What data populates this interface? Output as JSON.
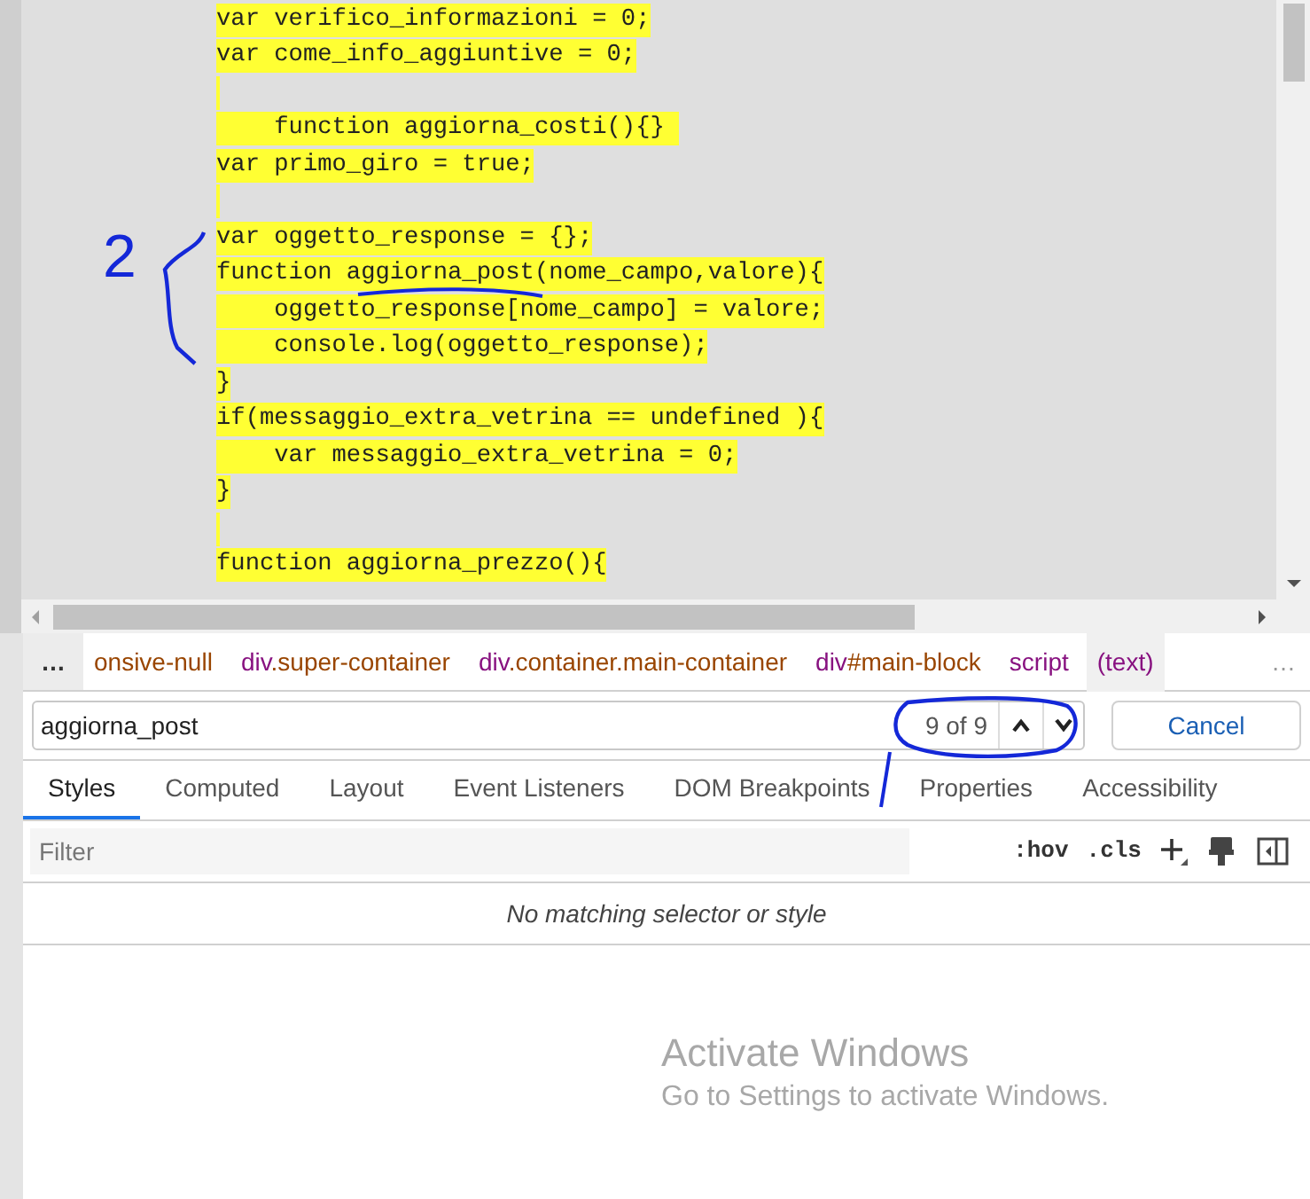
{
  "code_lines": [
    {
      "text": "var verifico_informazioni = 0;",
      "highlighted": true
    },
    {
      "text": "var come_info_aggiuntive = 0;",
      "highlighted": true
    },
    {
      "highlighted": true
    },
    {
      "text": "    function aggiorna_costi(){} ",
      "highlighted": true
    },
    {
      "text": "var primo_giro = true;",
      "highlighted": true
    },
    {
      "highlighted": true
    },
    {
      "text": "var oggetto_response = {};",
      "highlighted": true
    },
    {
      "text": "function aggiorna_post(nome_campo,valore){",
      "highlighted": true
    },
    {
      "text": "    oggetto_response[nome_campo] = valore;",
      "highlighted": true
    },
    {
      "text": "    console.log(oggetto_response);",
      "highlighted": true
    },
    {
      "text": "}",
      "highlighted": true
    },
    {
      "text": "if(messaggio_extra_vetrina == undefined ){",
      "highlighted": true
    },
    {
      "text": "    var messaggio_extra_vetrina = 0;",
      "highlighted": true
    },
    {
      "text": "}",
      "highlighted": true
    },
    {
      "highlighted": true
    },
    {
      "text": "function aggiorna_prezzo(){",
      "highlighted": true
    }
  ],
  "annotation": {
    "number": "2"
  },
  "breadcrumbs": {
    "more_left": "…",
    "more_right": "…",
    "items": [
      {
        "parts": [
          {
            "kind": "attr",
            "text": "onsive-null"
          }
        ],
        "selected": false
      },
      {
        "parts": [
          {
            "kind": "tag",
            "text": "div"
          },
          {
            "kind": "attr",
            "text": ".super-container"
          }
        ],
        "selected": false
      },
      {
        "parts": [
          {
            "kind": "tag",
            "text": "div"
          },
          {
            "kind": "attr",
            "text": ".container.main-container"
          }
        ],
        "selected": false
      },
      {
        "parts": [
          {
            "kind": "tag",
            "text": "div"
          },
          {
            "kind": "attr",
            "text": "#main-block"
          }
        ],
        "selected": false
      },
      {
        "parts": [
          {
            "kind": "tag",
            "text": "script"
          }
        ],
        "selected": false
      },
      {
        "parts": [
          {
            "kind": "tag",
            "text": "(text)"
          }
        ],
        "selected": true
      }
    ]
  },
  "search": {
    "value": "aggiorna_post",
    "count": "9 of 9",
    "cancel": "Cancel"
  },
  "tabs": [
    {
      "label": "Styles",
      "selected": true
    },
    {
      "label": "Computed",
      "selected": false
    },
    {
      "label": "Layout",
      "selected": false
    },
    {
      "label": "Event Listeners",
      "selected": false
    },
    {
      "label": "DOM Breakpoints",
      "selected": false
    },
    {
      "label": "Properties",
      "selected": false
    },
    {
      "label": "Accessibility",
      "selected": false
    }
  ],
  "filter": {
    "placeholder": "Filter",
    "hov": ":hov",
    "cls": ".cls"
  },
  "empty_message": "No matching selector or style",
  "os_notice": {
    "title": "Activate Windows",
    "subtitle": "Go to Settings to activate Windows."
  }
}
